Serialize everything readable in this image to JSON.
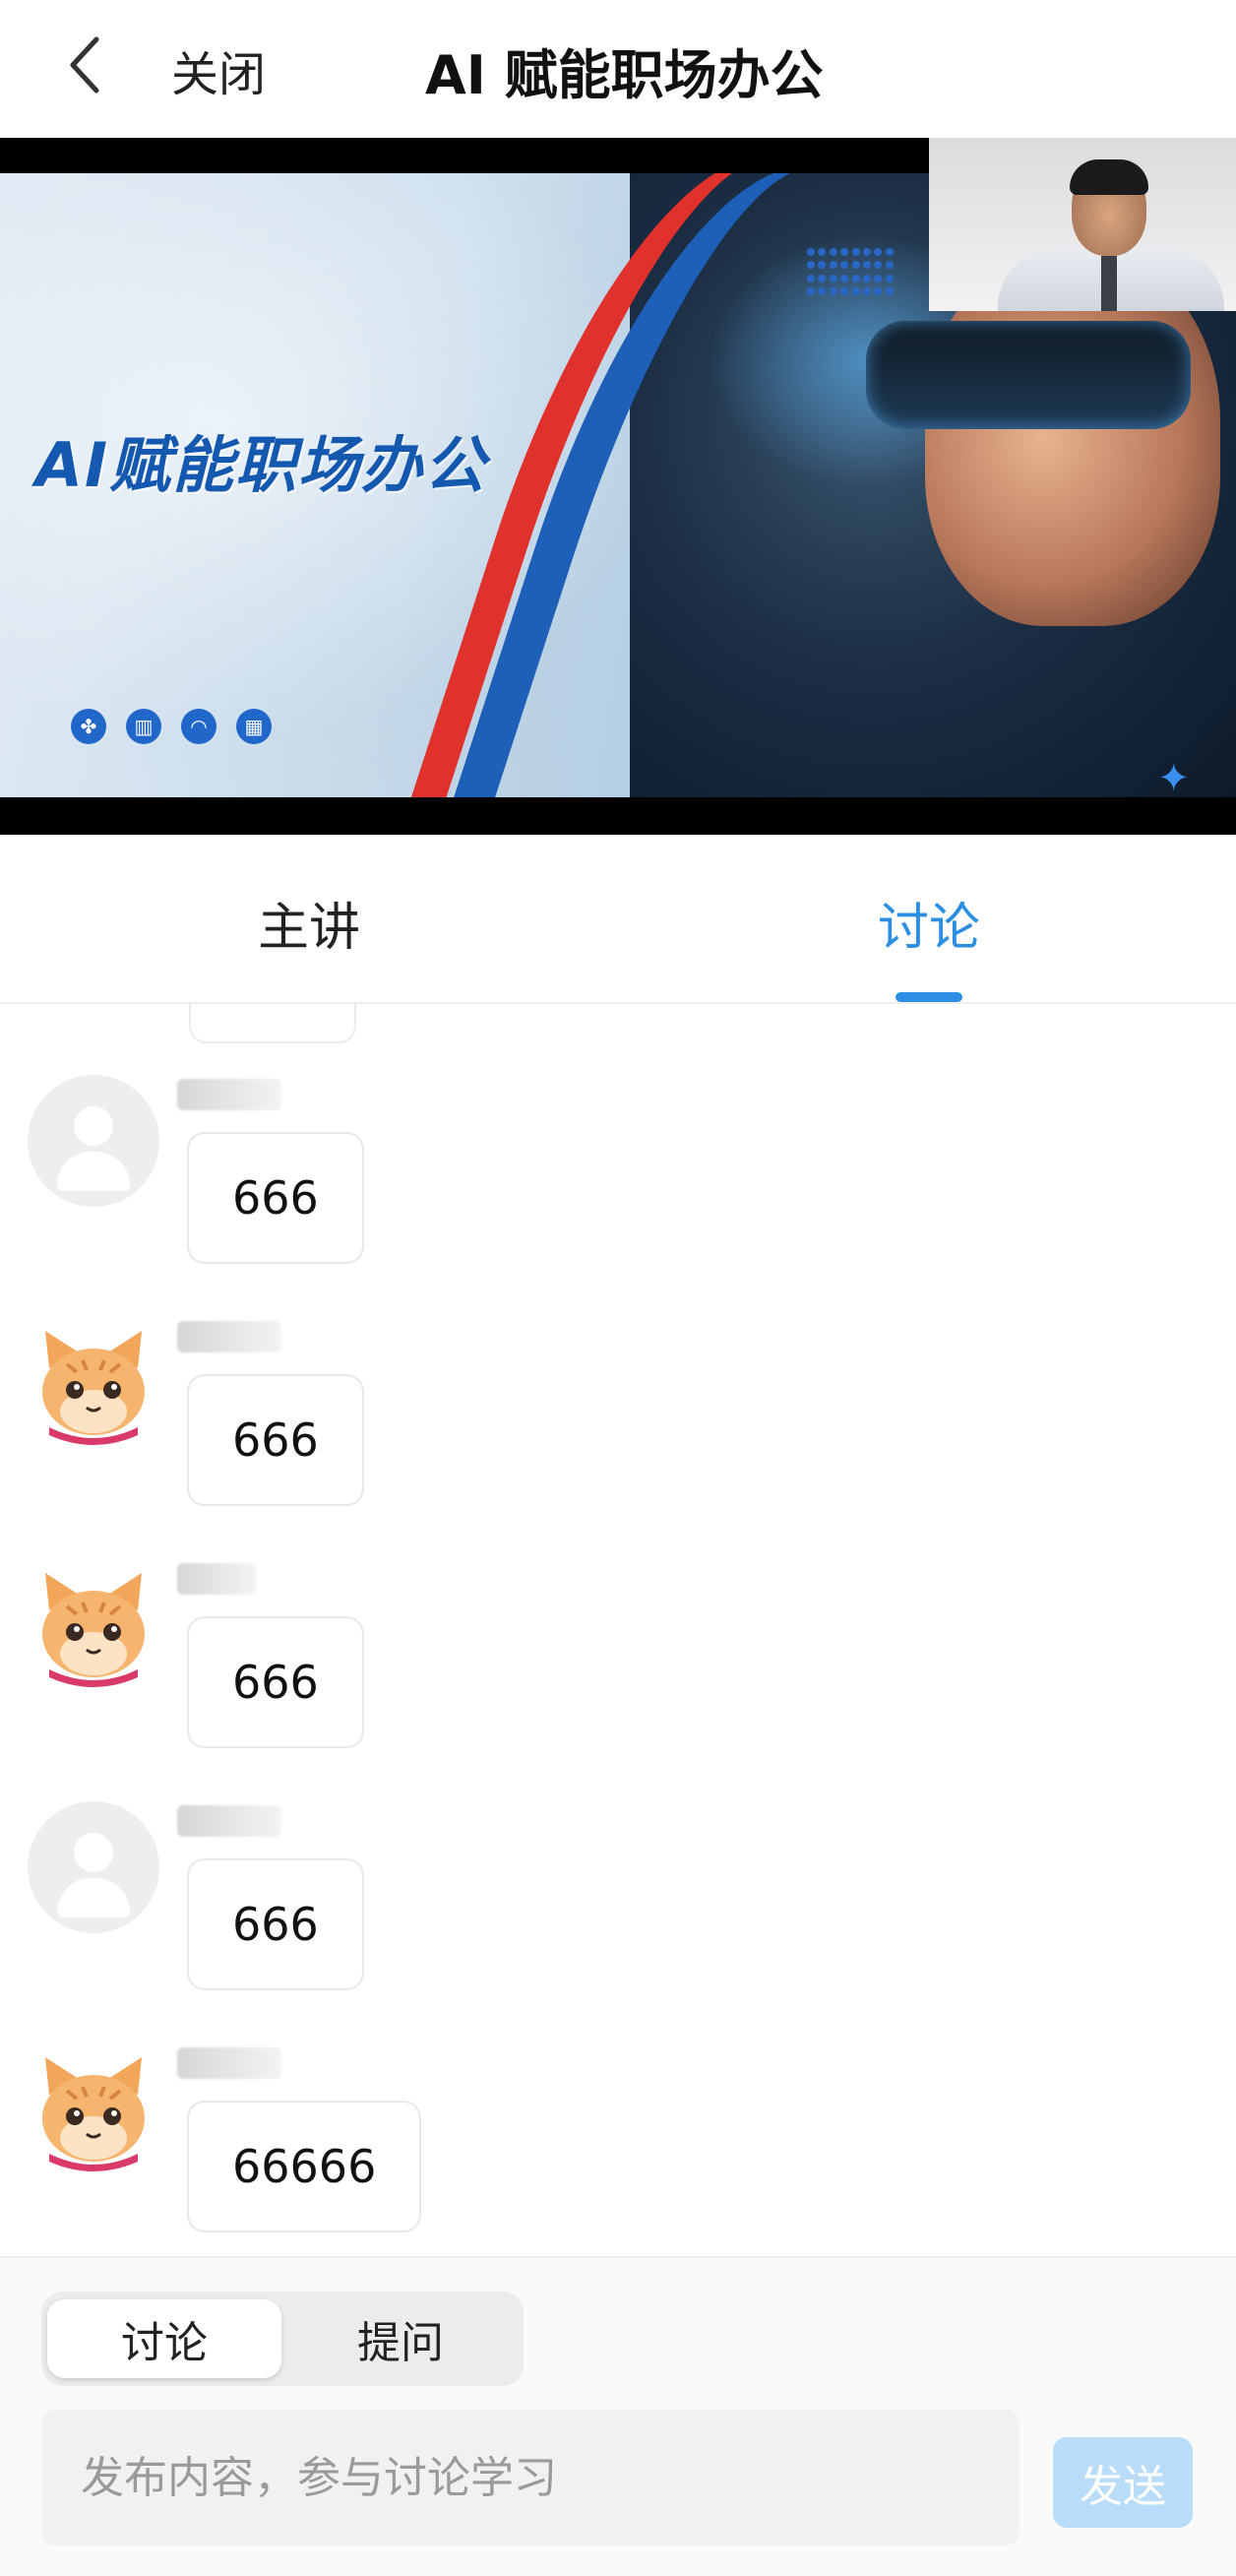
{
  "header": {
    "back_icon": "chevron-left-icon",
    "close_label": "关闭",
    "title": "AI 赋能职场办公"
  },
  "video": {
    "slide_title": "AI赋能职场办公",
    "slide_icons": [
      "clover-icon",
      "building-icon",
      "bell-icon",
      "calendar-icon"
    ],
    "accent_colors": {
      "blue": "#1e5fb8",
      "red": "#e0312c"
    }
  },
  "tabs": {
    "lecture": "主讲",
    "discuss": "讨论",
    "active": "讨论",
    "active_color": "#2d8fe3"
  },
  "messages": [
    {
      "avatar": "default-avatar-icon",
      "text": "666"
    },
    {
      "avatar": "cat-avatar-icon",
      "text": "666"
    },
    {
      "avatar": "cat-avatar-icon",
      "text": "666"
    },
    {
      "avatar": "default-avatar-icon",
      "text": "666"
    },
    {
      "avatar": "cat-avatar-icon",
      "text": "66666"
    }
  ],
  "composer": {
    "mode_discuss": "讨论",
    "mode_ask": "提问",
    "active_mode": "讨论",
    "placeholder": "发布内容，参与讨论学习",
    "send_label": "发送"
  }
}
